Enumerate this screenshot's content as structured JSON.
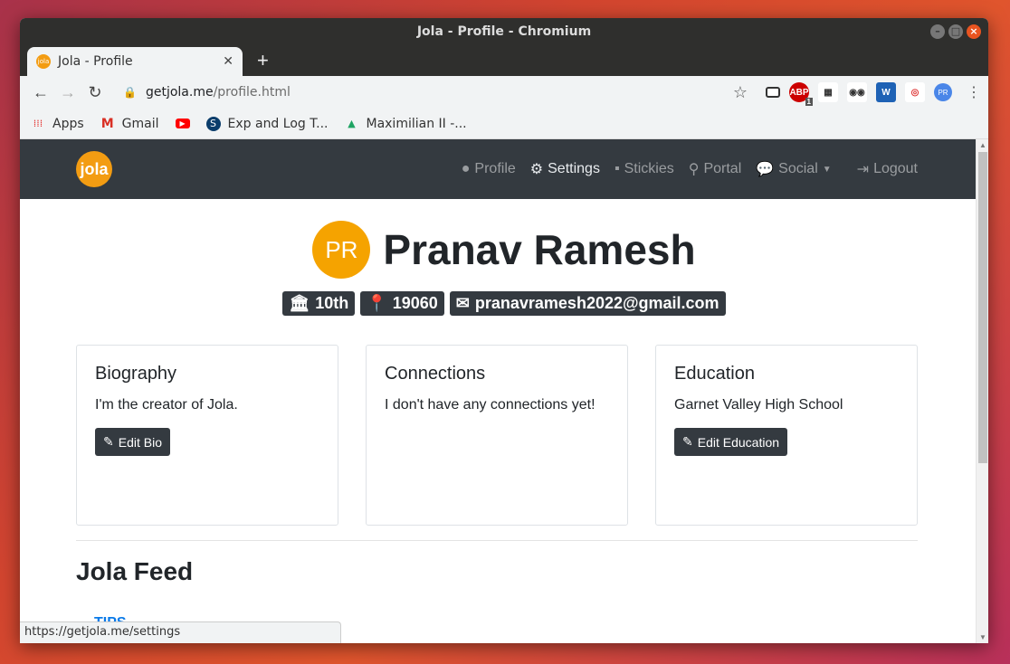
{
  "window": {
    "title": "Jola - Profile - Chromium"
  },
  "tab": {
    "title": "Jola - Profile",
    "favicon_label": "jola"
  },
  "address": {
    "host": "getjola.me",
    "path": "/profile.html"
  },
  "bookmarks": [
    {
      "label": "Apps",
      "icon": "apps-grid-icon"
    },
    {
      "label": "Gmail",
      "icon": "gmail-icon"
    },
    {
      "label": "",
      "icon": "youtube-icon"
    },
    {
      "label": "Exp and Log T...",
      "icon": "s-circle-icon"
    },
    {
      "label": "Maximilian II -...",
      "icon": "drive-icon"
    }
  ],
  "extensions": {
    "abp_count": "1",
    "profile_initials": "PR"
  },
  "navbar": {
    "logo": "jola",
    "links": [
      "Profile",
      "Settings",
      "Stickies",
      "Portal",
      "Social",
      "Logout"
    ]
  },
  "profile": {
    "initials": "PR",
    "name": "Pranav Ramesh",
    "grade": "10th",
    "zip": "19060",
    "email": "pranavramesh2022@gmail.com"
  },
  "cards": {
    "biography": {
      "title": "Biography",
      "text": "I'm the creator of Jola.",
      "button": "Edit Bio"
    },
    "connections": {
      "title": "Connections",
      "text": "I don't have any connections yet!"
    },
    "education": {
      "title": "Education",
      "text": "Garnet Valley High School",
      "button": "Edit Education"
    }
  },
  "feed": {
    "title": "Jola Feed",
    "tips": "TIPS"
  },
  "status": {
    "url": "https://getjola.me/settings"
  },
  "colors": {
    "accent": "#f39c12",
    "navbar": "#343a40",
    "link": "#0a7ae8"
  }
}
